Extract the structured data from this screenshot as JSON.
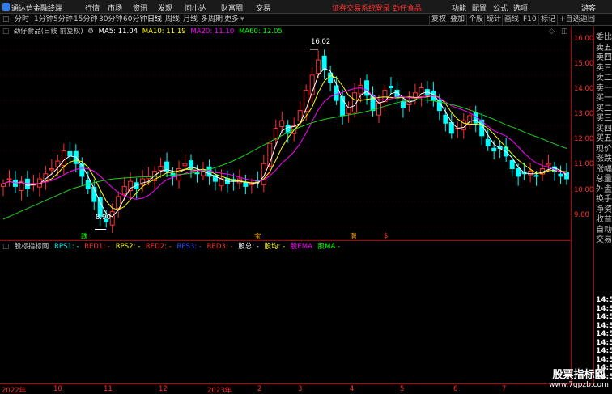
{
  "topbar": {
    "app_name": "通达信金融终端",
    "menus": [
      "行情",
      "市场",
      "资讯",
      "发现",
      "问小达",
      "财富圈",
      "交易"
    ],
    "alert": "证券交易系统登录  劲仔食品",
    "right_menus": [
      "功能",
      "配置",
      "公式",
      "选项",
      "游客"
    ]
  },
  "toolbar": {
    "periods": [
      "分时",
      "1分钟",
      "5分钟",
      "15分钟",
      "30分钟",
      "60分钟",
      "日线",
      "周线",
      "月线",
      "多周期",
      "更多"
    ],
    "active_period": "日线",
    "right_buttons": [
      "复权",
      "叠加",
      "个股",
      "统计",
      "画线",
      "F10",
      "标记",
      "+自选",
      "返回"
    ]
  },
  "info": {
    "stock": "劲仔食品(日线 前复权)",
    "ma5": "MA5: 11.04",
    "ma10": "MA10: 11.19",
    "ma20": "MA20: 11.10",
    "ma60": "MA60: 12.05",
    "colors": {
      "ma5": "#ffffff",
      "ma10": "#ffff00",
      "ma20": "#ff00ff",
      "ma60": "#00ff00"
    }
  },
  "yaxis": [
    "16.00",
    "15.00",
    "14.00",
    "13.00",
    "12.00",
    "11.00",
    "10.00",
    "9.00"
  ],
  "annotations": {
    "high": "16.02",
    "low": "8.90"
  },
  "markers": [
    "跌",
    "宝",
    "潜",
    "$"
  ],
  "indicator": {
    "name": "股标指标网",
    "items": [
      "RPS1: -",
      "RED1: -",
      "RPS2: -",
      "RED2: -",
      "RPS3: -",
      "RED3: -",
      "股总: -",
      "股均: -",
      "股EMA",
      "股MA -"
    ],
    "colors": [
      "#00ffff",
      "#ff3030",
      "#ffff00",
      "#ff3030",
      "#0000ff",
      "#ff3030",
      "#ffffff",
      "#ffff00",
      "#ff00ff",
      "#00ff00"
    ]
  },
  "side": {
    "labels": [
      "委比",
      "卖五",
      "卖四",
      "卖三",
      "卖二",
      "卖一",
      "买一",
      "买二",
      "买三",
      "买四",
      "买五",
      "现价",
      "涨跌",
      "涨幅",
      "总量",
      "外盘",
      "换手",
      "净资",
      "收益",
      "自动",
      "交易"
    ],
    "times": [
      "14:50",
      "14:50",
      "14:50",
      "14:50",
      "14:50",
      "14:50",
      "14:50",
      "14:50",
      "14:50",
      "14:50"
    ]
  },
  "xaxis": [
    "2022年",
    "10",
    "11",
    "12",
    "2023年",
    "2",
    "3",
    "4",
    "5",
    "6",
    "7"
  ],
  "watermark": {
    "line1": "股票指标网",
    "line2": "www.7gpzb.com"
  },
  "chart_data": {
    "type": "candlestick",
    "ylim": [
      8.5,
      16.5
    ],
    "high_label": 16.02,
    "low_label": 8.9,
    "close": [
      10.7,
      10.9,
      10.6,
      10.8,
      10.5,
      10.7,
      10.9,
      11.1,
      11.3,
      11.6,
      12.0,
      11.8,
      11.5,
      11.0,
      10.5,
      10.0,
      9.4,
      9.2,
      9.6,
      10.2,
      10.6,
      10.8,
      10.5,
      10.9,
      11.0,
      11.2,
      11.4,
      11.2,
      11.0,
      11.3,
      11.5,
      11.3,
      11.1,
      11.2,
      11.0,
      10.8,
      10.9,
      10.7,
      10.8,
      10.9,
      10.6,
      10.7,
      10.8,
      11.5,
      12.3,
      12.9,
      13.2,
      12.7,
      13.0,
      13.6,
      14.4,
      15.0,
      15.6,
      15.2,
      14.7,
      14.0,
      13.4,
      13.7,
      14.3,
      14.6,
      14.2,
      13.6,
      13.9,
      14.4,
      14.5,
      14.1,
      13.7,
      14.0,
      14.3,
      14.5,
      14.2,
      14.0,
      13.6,
      13.1,
      12.7,
      12.9,
      13.2,
      13.4,
      13.1,
      12.6,
      12.2,
      12.0,
      12.1,
      11.8,
      11.3,
      11.0,
      11.1,
      11.2,
      11.0,
      11.3,
      11.5,
      11.2,
      11.0,
      10.9
    ],
    "ma60": [
      9.3,
      9.45,
      9.6,
      9.75,
      9.9,
      10.05,
      10.2,
      10.35,
      10.5,
      10.6,
      10.7,
      10.78,
      10.85,
      10.9,
      10.93,
      10.95,
      10.97,
      10.98,
      11.0,
      11.02,
      11.05,
      11.08,
      11.12,
      11.18,
      11.26,
      11.36,
      11.48,
      11.62,
      11.78,
      11.96,
      12.14,
      12.32,
      12.5,
      12.68,
      12.84,
      12.98,
      13.1,
      13.2,
      13.28,
      13.34,
      13.4,
      13.46,
      13.52,
      13.6,
      13.7,
      13.8,
      13.9,
      13.98,
      14.02,
      14.03,
      14.0,
      13.95,
      13.88,
      13.8,
      13.7,
      13.58,
      13.45,
      13.32,
      13.18,
      13.02,
      12.9,
      12.75,
      12.62,
      12.5,
      12.36,
      12.22,
      12.1
    ]
  }
}
